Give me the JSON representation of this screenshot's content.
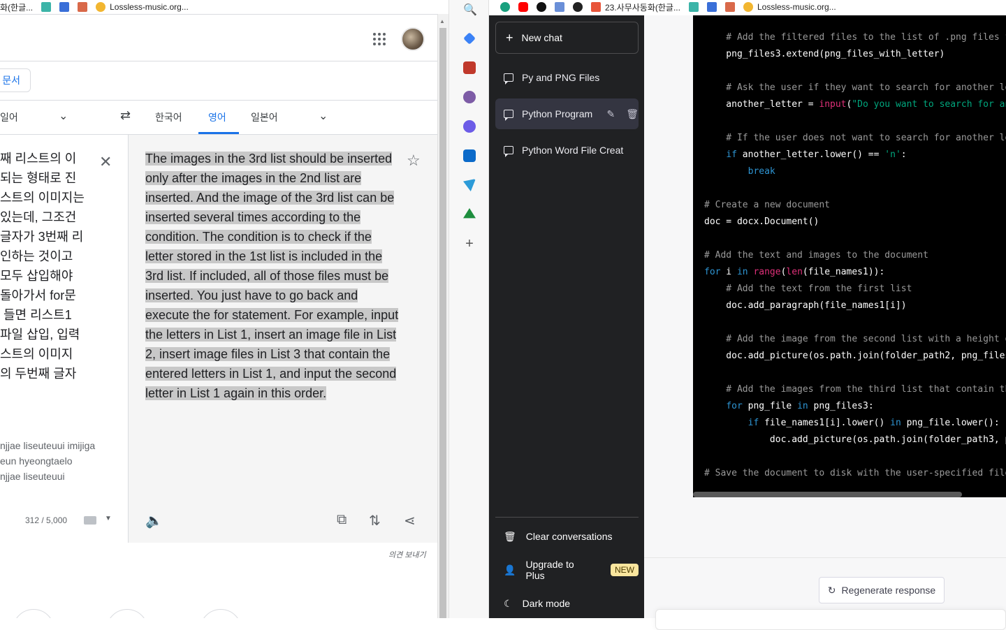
{
  "bookmarks_left": {
    "item0": "화(한글...",
    "item1": "Lossless-music.org..."
  },
  "bookmarks_right": {
    "item0": "23.사무사동화(한글...",
    "item1": "Lossless-music.org..."
  },
  "translate": {
    "doc_button": "문서",
    "source_lang": "일어",
    "swap_icon": "swap-arrows",
    "target_langs": [
      "한국어",
      "영어",
      "일본어"
    ],
    "active_target": "영어",
    "source_text": "째 리스트의 이\n되는 형태로 진\n스트의 이미지는\n있는데, 그조건\n글자가 3번째 리\n인하는 것이고\n모두 삽입해야\n돌아가서 for문\n 들면 리스트1\n파일 삽입, 입력\n스트의 이미지\n의 두번째 글자",
    "romanization": "njjae liseuteuui imijiga\neun hyeongtaelo\nnjjae liseuteuui",
    "char_count": "312 / 5,000",
    "translation": "The images in the 3rd list should be inserted only after the images in the 2nd list are inserted. And the image of the 3rd list can be inserted several times according to the condition. The condition is to check if the letter stored in the 1st list is included in the 3rd list. If included, all of those files must be inserted. You just have to go back and execute the for statement. For example, input the letters in List 1, insert an image file in List 2, insert image files in List 3 that contain the entered letters in List 1, and input the second letter in List 1 again in this order.",
    "feedback": "의견 보내기"
  },
  "chat": {
    "new_chat": "New chat",
    "conversations": [
      "Py and PNG Files",
      "Python Program",
      "Python Word File Creat"
    ],
    "clear": "Clear conversations",
    "upgrade": "Upgrade to Plus",
    "new_badge": "NEW",
    "dark_mode": "Dark mode",
    "regenerate": "Regenerate response"
  },
  "colors": {
    "accent_blue": "#1a73e8",
    "chat_sidebar": "#202123",
    "code_bg": "#000000",
    "badge": "#fae69e"
  }
}
